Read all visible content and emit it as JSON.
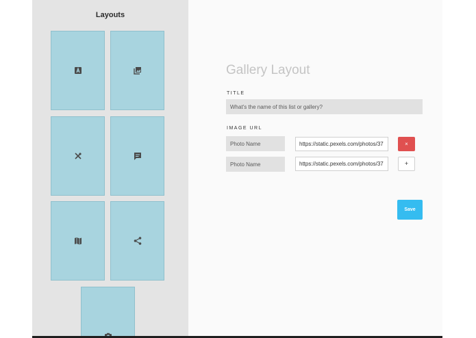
{
  "sidebar": {
    "title": "Layouts",
    "tiles": [
      {
        "icon": "text-icon"
      },
      {
        "icon": "photo-library-icon"
      },
      {
        "icon": "restaurant-icon"
      },
      {
        "icon": "chat-icon"
      },
      {
        "icon": "map-icon"
      },
      {
        "icon": "share-icon"
      },
      {
        "icon": "camera-icon"
      }
    ]
  },
  "form": {
    "heading": "Gallery Layout",
    "title_label": "TITLE",
    "title_placeholder": "What's the name of this list or gallery?",
    "image_url_label": "IMAGE URL",
    "rows": [
      {
        "name_placeholder": "Photo Name",
        "url_value": "https://static.pexels.com/photos/37",
        "action": "×"
      },
      {
        "name_placeholder": "Photo Name",
        "url_value": "https://static.pexels.com/photos/37",
        "action": "+"
      }
    ],
    "save_label": "Save"
  },
  "colors": {
    "sidebar_bg": "#e4e4e4",
    "tile": "#a8d4df",
    "remove": "#e05050",
    "save": "#35bcf0"
  }
}
